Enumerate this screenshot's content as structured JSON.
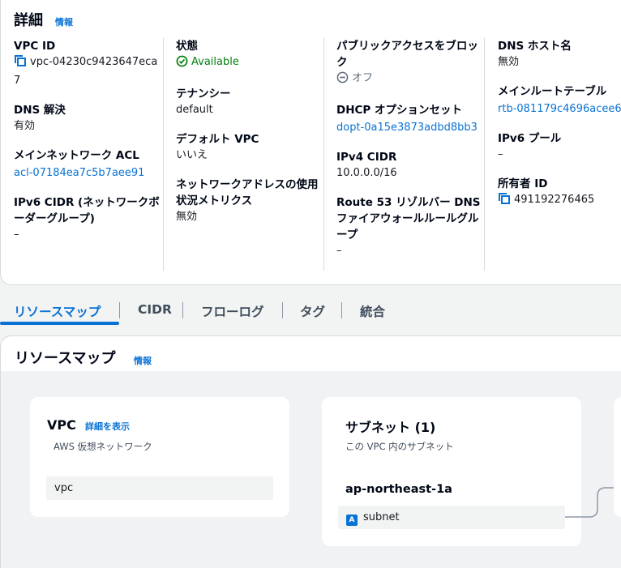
{
  "details": {
    "title": "詳細",
    "info": "情報",
    "columns": [
      [
        {
          "label": "VPC ID",
          "value": "vpc-04230c9423647eca7"
        },
        {
          "label": "DNS 解決",
          "value": "有効"
        },
        {
          "label": "メインネットワーク ACL",
          "value": "acl-07184ea7c5b7aee91"
        },
        {
          "label": "IPv6 CIDR (ネットワークボーダーグループ)",
          "value": "–"
        }
      ],
      [
        {
          "label": "状態",
          "value": "Available"
        },
        {
          "label": "テナンシー",
          "value": "default"
        },
        {
          "label": "デフォルト VPC",
          "value": "いいえ"
        },
        {
          "label": "ネットワークアドレスの使用状況メトリクス",
          "value": "無効"
        }
      ],
      [
        {
          "label": "パブリックアクセスをブロック",
          "value": "オフ"
        },
        {
          "label": "DHCP オプションセット",
          "value": "dopt-0a15e3873adbd8bb3"
        },
        {
          "label": "IPv4 CIDR",
          "value": "10.0.0.0/16"
        },
        {
          "label": "Route 53 リゾルバー DNS ファイアウォールルールグループ",
          "value": "–"
        }
      ],
      [
        {
          "label": "DNS ホスト名",
          "value": "無効"
        },
        {
          "label": "メインルートテーブル",
          "value": "rtb-081179c4696acee6"
        },
        {
          "label": "IPv6 プール",
          "value": "–"
        },
        {
          "label": "所有者 ID",
          "value": "491192276465"
        }
      ]
    ]
  },
  "tabs": [
    "リソースマップ",
    "CIDR",
    "フローログ",
    "タグ",
    "統合"
  ],
  "resource_map": {
    "title": "リソースマップ",
    "info": "情報",
    "vpc_card": {
      "title": "VPC",
      "link": "詳細を表示",
      "subtitle": "AWS 仮想ネットワーク",
      "item": "vpc"
    },
    "subnet_card": {
      "title": "サブネット (1)",
      "subtitle": "この VPC 内のサブネット",
      "az": "ap-northeast-1a",
      "badge": "A",
      "item": "subnet"
    }
  },
  "colors": {
    "link": "#0972d3",
    "available": "#037f0c"
  },
  "icons": [
    "copy-icon",
    "check-circle-icon",
    "minus-circle-icon"
  ]
}
